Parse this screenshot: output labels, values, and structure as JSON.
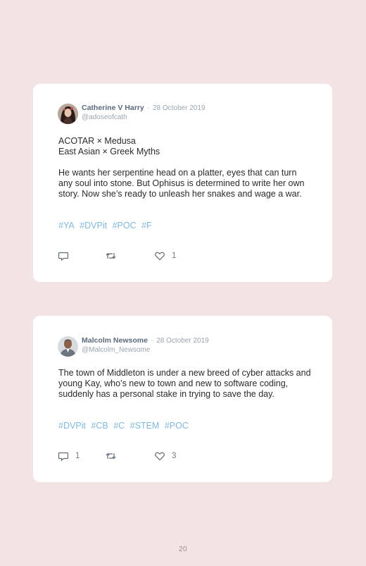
{
  "tweets": [
    {
      "name": "Catherine V Harry",
      "separator": "·",
      "date": "28 October 2019",
      "handle": "@adoseofcath",
      "paragraphs": [
        "ACOTAR × Medusa\nEast Asian × Greek Myths",
        "He wants her serpentine head on a platter, eyes that can turn any soul into stone. But Ophisus is determined to write her own story. Now she’s ready to unleash her snakes and wage a war."
      ],
      "hashtags": [
        "#YA",
        "#DVPit",
        "#POC",
        "#F"
      ],
      "reply_count": "",
      "retweet_count": "",
      "like_count": "1"
    },
    {
      "name": "Malcolm Newsome",
      "separator": "·",
      "date": "28 October 2019",
      "handle": "@Malcolm_Newsome",
      "paragraphs": [
        "The town of Middleton is under a new breed of cyber attacks and young Kay, who’s new to town and new to software coding, suddenly has a personal stake in trying to save the day."
      ],
      "hashtags": [
        "#DVPit",
        "#CB",
        "#C",
        "#STEM",
        "#POC"
      ],
      "reply_count": "1",
      "retweet_count": "",
      "like_count": "3"
    }
  ],
  "icons": {
    "reply": "comment-bubble-icon",
    "retweet": "retweet-arrows-icon",
    "like": "heart-icon"
  },
  "colors": {
    "background": "#f2e4e4",
    "card": "#ffffff",
    "hashtag": "#7fb8dc",
    "name": "#5a6a7a",
    "meta": "#9aa4ae"
  },
  "page_number": "20"
}
